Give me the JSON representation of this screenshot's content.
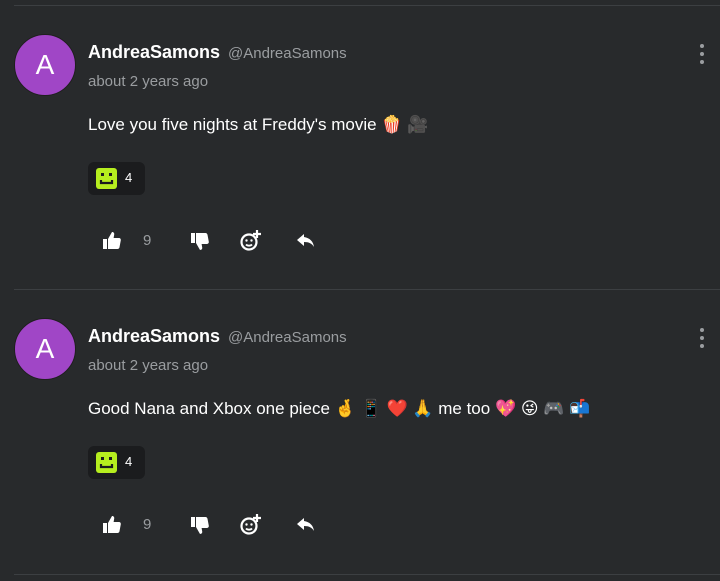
{
  "comments": [
    {
      "avatar_letter": "A",
      "author": "AndreaSamons",
      "handle": "@AndreaSamons",
      "time": "about 2 years ago",
      "text": "Love you five nights at Freddy's movie 🍿 🎥",
      "reaction": {
        "icon": "square-smiley-icon",
        "count": "4"
      },
      "likes": "9"
    },
    {
      "avatar_letter": "A",
      "author": "AndreaSamons",
      "handle": "@AndreaSamons",
      "time": "about 2 years ago",
      "text": "Good Nana and Xbox one piece 🤞 📱 ❤️ 🙏 me too 💖 😜 🎮 📬",
      "reaction": {
        "icon": "square-smiley-icon",
        "count": "4"
      },
      "likes": "9"
    }
  ],
  "colors": {
    "background": "#282a2c",
    "avatar": "#a046c6",
    "reaction_icon": "#b6ee1f"
  }
}
